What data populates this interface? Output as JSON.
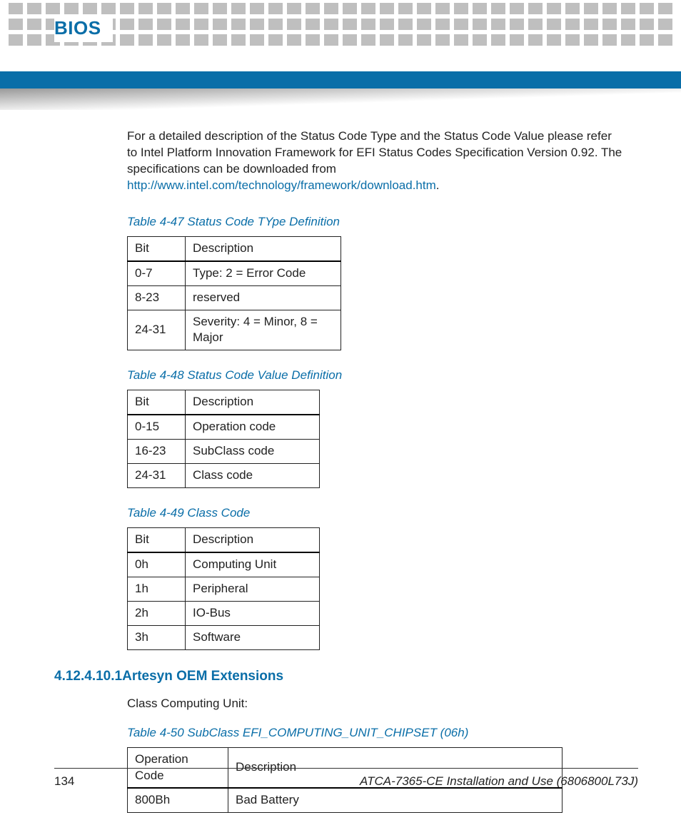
{
  "header": {
    "title": "BIOS"
  },
  "intro": {
    "text": "For a detailed description of the Status Code Type and the Status Code Value please refer to Intel Platform Innovation Framework for EFI Status Codes Specification Version 0.92. The specifications can be downloaded from ",
    "link": "http://www.intel.com/technology/framework/download.htm",
    "after": "."
  },
  "tables": {
    "t47": {
      "caption": "Table 4-47 Status Code TYpe Definition",
      "head": [
        "Bit",
        "Description"
      ],
      "rows": [
        [
          "0-7",
          "Type: 2 = Error Code"
        ],
        [
          "8-23",
          "reserved"
        ],
        [
          "24-31",
          "Severity: 4 = Minor, 8 = Major"
        ]
      ]
    },
    "t48": {
      "caption": "Table 4-48 Status Code Value Definition",
      "head": [
        "Bit",
        "Description"
      ],
      "rows": [
        [
          "0-15",
          "Operation code"
        ],
        [
          "16-23",
          "SubClass code"
        ],
        [
          "24-31",
          "Class code"
        ]
      ]
    },
    "t49": {
      "caption": "Table 4-49 Class Code",
      "head": [
        "Bit",
        "Description"
      ],
      "rows": [
        [
          "0h",
          "Computing Unit"
        ],
        [
          "1h",
          "Peripheral"
        ],
        [
          "2h",
          "IO-Bus"
        ],
        [
          "3h",
          "Software"
        ]
      ]
    },
    "t50": {
      "caption": "Table 4-50 SubClass EFI_COMPUTING_UNIT_CHIPSET (06h)",
      "head": [
        "Operation Code",
        "Description"
      ],
      "rows": [
        [
          "800Bh",
          "Bad Battery"
        ]
      ]
    }
  },
  "section": {
    "number": "4.12.4.10.1",
    "title": "Artesyn OEM Extensions",
    "subtext": "Class Computing Unit:"
  },
  "footer": {
    "page": "134",
    "doc": "ATCA-7365-CE Installation and Use (6806800L73J)"
  }
}
